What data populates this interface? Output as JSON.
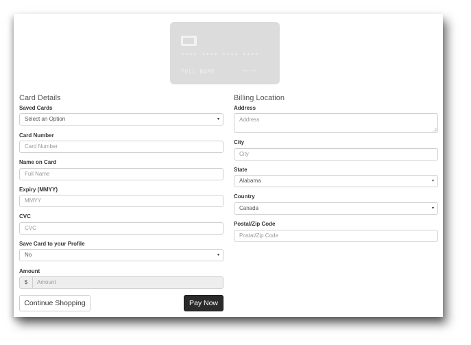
{
  "card_preview": {
    "number": "**** **** **** ****",
    "name": "FULL NAME",
    "expiry": "**/**"
  },
  "card_details": {
    "title": "Card Details",
    "saved_cards": {
      "label": "Saved Cards",
      "value": "Select an Option"
    },
    "card_number": {
      "label": "Card Number",
      "placeholder": "Card Number"
    },
    "name_on_card": {
      "label": "Name on Card",
      "placeholder": "Full Name"
    },
    "expiry": {
      "label": "Expiry (MMYY)",
      "placeholder": "MMYY"
    },
    "cvc": {
      "label": "CVC",
      "placeholder": "CVC"
    },
    "save_card": {
      "label": "Save Card to your Profile",
      "value": "No"
    },
    "amount": {
      "label": "Amount",
      "currency": "$",
      "placeholder": "Amount"
    }
  },
  "billing": {
    "title": "Billing Location",
    "address": {
      "label": "Address",
      "placeholder": "Address"
    },
    "city": {
      "label": "City",
      "placeholder": "City"
    },
    "state": {
      "label": "State",
      "value": "Alabama"
    },
    "country": {
      "label": "Country",
      "value": "Canada"
    },
    "postal": {
      "label": "Postal/Zip Code",
      "placeholder": "Postal/Zip Code"
    }
  },
  "actions": {
    "continue_label": "Continue Shopping",
    "pay_label": "Pay Now"
  },
  "colors": {
    "card_bg": "#dcdcdc",
    "pay_button": "#2b2b2b"
  },
  "icons": {
    "select_caret": "▾"
  }
}
